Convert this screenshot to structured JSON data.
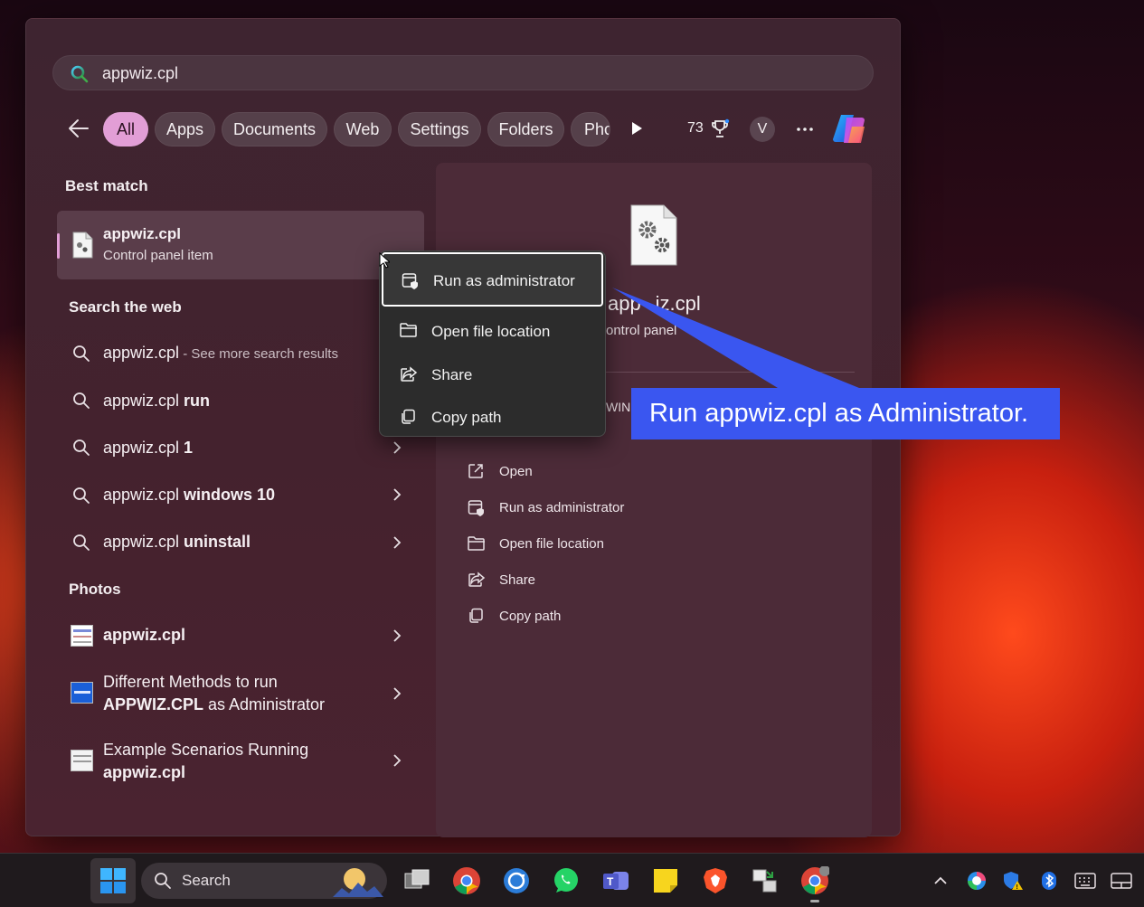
{
  "search": {
    "query": "appwiz.cpl"
  },
  "filters": {
    "items": [
      "All",
      "Apps",
      "Documents",
      "Web",
      "Settings",
      "Folders",
      "Phc"
    ],
    "points": "73",
    "avatar_letter": "V"
  },
  "best_match": {
    "title": "Best match",
    "name": "appwiz.cpl",
    "subtitle": "Control panel item"
  },
  "web": {
    "title": "Search the web",
    "items": [
      {
        "prefix": "appwiz.cpl",
        "suffix": " - See more search results"
      },
      {
        "prefix": "appwiz.cpl ",
        "bold": "run"
      },
      {
        "prefix": "appwiz.cpl ",
        "bold": "1"
      },
      {
        "prefix": "appwiz.cpl ",
        "bold": "windows 10"
      },
      {
        "prefix": "appwiz.cpl ",
        "bold": "uninstall"
      }
    ]
  },
  "photos": {
    "title": "Photos",
    "items": [
      {
        "line1": "appwiz.cpl"
      },
      {
        "line1": "Different Methods to run",
        "line2_bold": "APPWIZ.CPL",
        "line2_rest": " as Administrator"
      },
      {
        "line1": "Example Scenarios Running",
        "line2_bold": "appwiz.cpl"
      }
    ]
  },
  "preview": {
    "name_visible": "app",
    "name_tail": "iz.cpl",
    "type_visible": "ontrol panel",
    "location_fragment": "WIN",
    "actions": [
      "Open",
      "Run as administrator",
      "Open file location",
      "Share",
      "Copy path"
    ]
  },
  "context_menu": {
    "items": [
      "Run as administrator",
      "Open file location",
      "Share",
      "Copy path"
    ]
  },
  "callout": {
    "text": "Run appwiz.cpl as Administrator.",
    "color": "#3a56f0"
  },
  "taskbar": {
    "search_label": "Search"
  },
  "colors": {
    "accent": "#e29ed6",
    "panel": "#45222e",
    "menu": "#2c2c2c"
  }
}
